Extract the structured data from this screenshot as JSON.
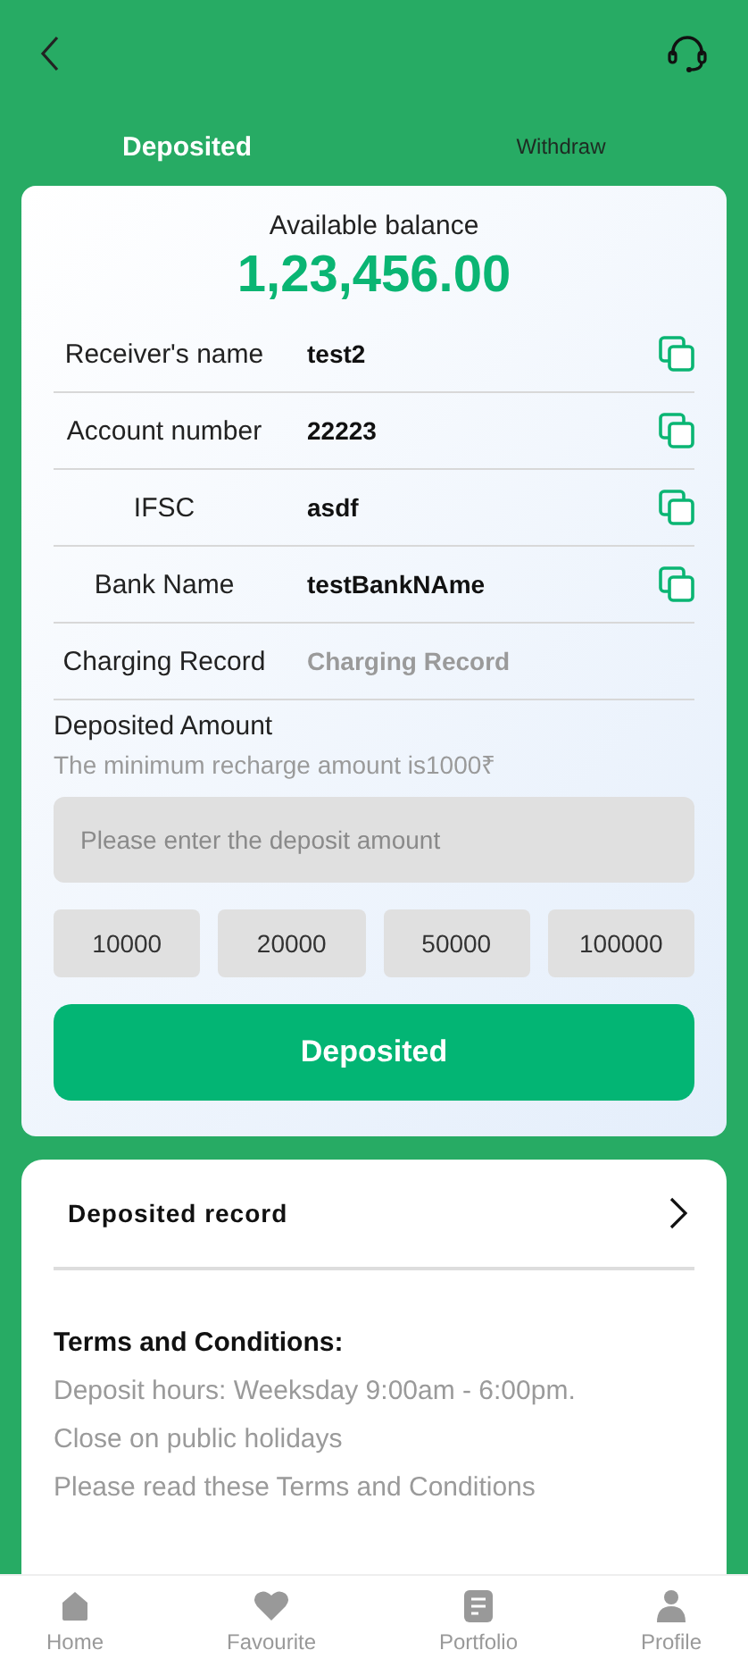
{
  "tabs": [
    {
      "label": "Deposited",
      "selected": true
    },
    {
      "label": "Withdraw",
      "selected": false
    }
  ],
  "balance": {
    "label": "Available balance",
    "amount": "1,23,456.00"
  },
  "details": [
    {
      "kind": "copy",
      "label": "Receiver's name",
      "value": "test2"
    },
    {
      "kind": "copy",
      "label": "Account number",
      "value": "22223"
    },
    {
      "kind": "copy",
      "label": "IFSC",
      "value": "asdf"
    },
    {
      "kind": "copy",
      "label": "Bank Name",
      "value": "testBankNAme"
    },
    {
      "kind": "muted",
      "label": "Charging Record",
      "value": "Charging Record"
    }
  ],
  "amount": {
    "label": "Deposited Amount",
    "hint": "The minimum recharge amount is1000₹",
    "placeholder": "Please enter the deposit amount"
  },
  "presets": [
    "10000",
    "20000",
    "50000",
    "100000"
  ],
  "submit": "Deposited",
  "record_link": "Deposited record",
  "terms": {
    "title": "Terms and Conditions:",
    "lines": [
      "Deposit hours: Weeksday 9:00am - 6:00pm.",
      "Close on public holidays",
      "Please read these Terms and Conditions"
    ]
  },
  "nav": [
    {
      "kind": "home",
      "label": "Home"
    },
    {
      "kind": "favourite",
      "label": "Favourite"
    },
    {
      "kind": "portfolio",
      "label": "Portfolio"
    },
    {
      "kind": "profile",
      "label": "Profile"
    }
  ]
}
